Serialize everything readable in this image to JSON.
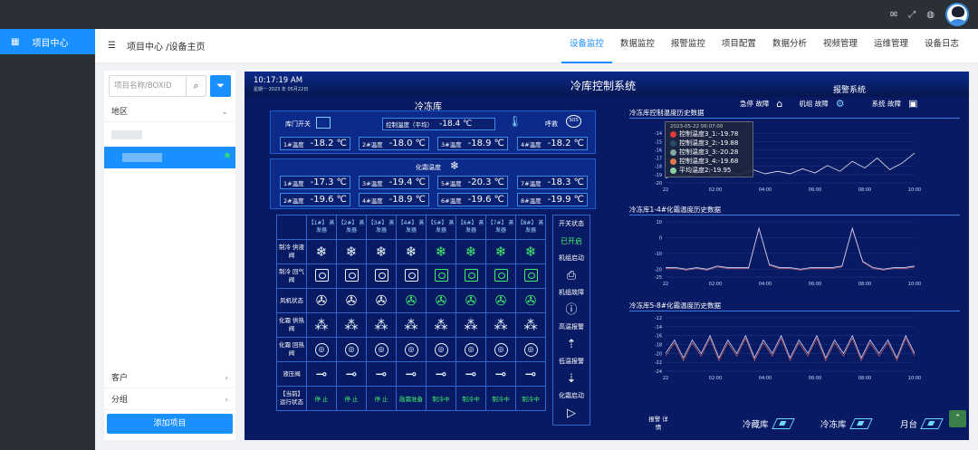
{
  "nav": {
    "item_label": "项目中心"
  },
  "header": {
    "breadcrumb": "项目中心 /设备主页",
    "tabs": [
      "设备监控",
      "数据监控",
      "报警监控",
      "项目配置",
      "数据分析",
      "视频管理",
      "运维管理",
      "设备日志"
    ]
  },
  "left": {
    "search_placeholder": "项目名称/BOXID",
    "region_label": "地区",
    "customer_label": "客户",
    "group_label": "分组",
    "add_label": "添加项目"
  },
  "monitor": {
    "time": "10:17:19 AM",
    "date": "星期一  2023 年 05月22日",
    "system_title": "冷库控制系统",
    "section_title": "冷冻库",
    "alarm_title": "报警系统",
    "alarm_items": [
      "急停 故障",
      "机组 故障",
      "系统 故障"
    ],
    "door_label": "库门开关",
    "ctrl_temp_label": "控制温度（平均）",
    "ctrl_temp_value": "-18.4 ℃",
    "call_label": "呼救",
    "temps_top": [
      {
        "n": "1#温度",
        "v": "-18.2 ℃"
      },
      {
        "n": "2#温度",
        "v": "-18.0 ℃"
      },
      {
        "n": "3#温度",
        "v": "-18.9 ℃"
      },
      {
        "n": "4#温度",
        "v": "-18.2 ℃"
      }
    ],
    "defrost_label": "化霜温度",
    "temps_defrost": [
      {
        "n": "1#温度",
        "v": "-17.3 ℃"
      },
      {
        "n": "3#温度",
        "v": "-19.4 ℃"
      },
      {
        "n": "5#温度",
        "v": "-20.3 ℃"
      },
      {
        "n": "7#温度",
        "v": "-18.3 ℃"
      },
      {
        "n": "2#温度",
        "v": "-19.6 ℃"
      },
      {
        "n": "4#温度",
        "v": "-18.9 ℃"
      },
      {
        "n": "6#温度",
        "v": "-19.6 ℃"
      },
      {
        "n": "8#温度",
        "v": "-19.9 ℃"
      }
    ],
    "evap_headers": [
      "【1#】 蒸发器",
      "【2#】 蒸发器",
      "【3#】 蒸发器",
      "【4#】 蒸发器",
      "【5#】 蒸发器",
      "【6#】 蒸发器",
      "【7#】 蒸发器",
      "【8#】 蒸发器"
    ],
    "row_labels": [
      "制冷 供液阀",
      "制冷 回气阀",
      "风机状态",
      "化霜 供热阀",
      "化霜 回热阀",
      "液压阀",
      "【当前】 运行状态"
    ],
    "run_states": [
      "停 止",
      "停 止",
      "停 止",
      "融霜准备",
      "制冷中",
      "制冷中",
      "制冷中",
      "制冷中"
    ],
    "status_labels": [
      "开关状态",
      "已开启",
      "机组启动",
      "机组故障",
      "高温报警",
      "低温报警",
      "化霜启动"
    ],
    "alarm_detail_label": "报警 详情",
    "bottom_nav": [
      "冷藏库",
      "冷冻库",
      "月台"
    ],
    "colors": {
      "accent": "#1890ff",
      "panel": "#081a63",
      "green": "#3ef06a"
    }
  },
  "chart_data": [
    {
      "type": "line",
      "title": "冷冻库控制温度历史数据",
      "x": [
        "22",
        "02:00",
        "04:00",
        "06:00",
        "08:00",
        "10:00"
      ],
      "ylim": [
        -20,
        -13
      ],
      "yticks": [
        -14,
        -15,
        -16,
        -17,
        -18,
        -19,
        -20
      ],
      "series": [
        {
          "name": "控制温度3_1",
          "values": [
            -19.4,
            -19.0,
            -19.2,
            -18.5,
            -19.1,
            -18.7,
            -19.0,
            -18.4,
            -18.9,
            -18.6,
            -18.9,
            -18.3,
            -18.8,
            -17.9,
            -18.6,
            -17.4,
            -18.2,
            -17.0,
            -18.4,
            -17.6,
            -16.4
          ]
        }
      ],
      "tooltip": {
        "date": "2023-05-22 06:07:00",
        "entries": [
          "控制温度3_1:-19.78",
          "控制温度3_2:-19.88",
          "控制温度3_3:-20.28",
          "控制温度3_4:-19.68",
          "平均温度2:-19.95"
        ]
      }
    },
    {
      "type": "line",
      "title": "冷冻库1-4#化霜温度历史数据",
      "x": [
        "22",
        "02:00",
        "04:00",
        "06:00",
        "08:00",
        "10:00"
      ],
      "ylim": [
        -25,
        10
      ],
      "yticks": [
        10,
        0,
        -10,
        -20,
        -25
      ],
      "series": [
        {
          "name": "",
          "values": [
            -19,
            -19,
            -20,
            -19,
            -20,
            -18,
            -19,
            -19,
            -19,
            6,
            -17,
            -19,
            -19,
            -20,
            -19,
            -19,
            -19,
            -18,
            6,
            -15,
            -19,
            -20,
            -19,
            -19,
            -18
          ]
        }
      ]
    },
    {
      "type": "line",
      "title": "冷冻库5-8#化霜温度历史数据",
      "x": [
        "22",
        "02:00",
        "04:00",
        "06:00",
        "08:00",
        "10:00"
      ],
      "ylim": [
        -24,
        -12
      ],
      "yticks": [
        -12,
        -14,
        -16,
        -18,
        -20,
        -22,
        -24
      ],
      "series": [
        {
          "name": "",
          "values": [
            -20,
            -17,
            -21,
            -17,
            -20,
            -16,
            -21,
            -17,
            -20,
            -16,
            -21,
            -17,
            -20,
            -16,
            -21,
            -17,
            -20,
            -16,
            -21,
            -17,
            -20,
            -16,
            -21,
            -17,
            -20,
            -17,
            -21,
            -16,
            -20
          ]
        }
      ]
    }
  ]
}
